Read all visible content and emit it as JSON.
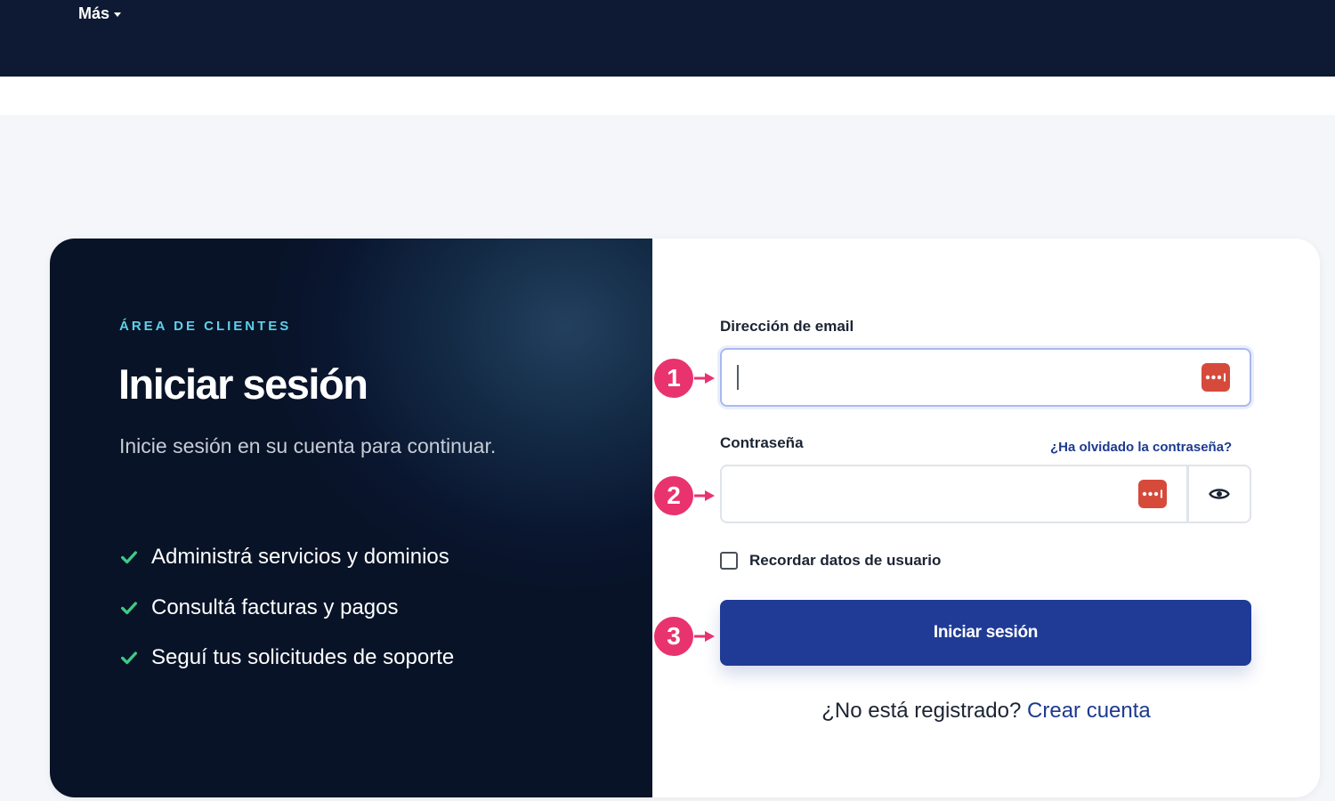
{
  "nav": {
    "more_label": "Más"
  },
  "hero": {
    "eyebrow": "ÁREA DE CLIENTES",
    "title": "Iniciar sesión",
    "subtitle": "Inicie sesión en su cuenta para continuar.",
    "features": [
      "Administrá servicios y dominios",
      "Consultá facturas y pagos",
      "Seguí tus solicitudes de soporte"
    ]
  },
  "form": {
    "email_label": "Dirección de email",
    "email_value": "",
    "password_label": "Contraseña",
    "password_value": "",
    "forgot_label": "¿Ha olvidado la contraseña?",
    "remember_label": "Recordar datos de usuario",
    "remember_checked": false,
    "submit_label": "Iniciar sesión",
    "register_prompt": "¿No está registrado?",
    "register_link": "Crear cuenta"
  },
  "annotations": [
    "1",
    "2",
    "3"
  ],
  "icons": {
    "nav_more": "chevron-down-icon",
    "feature": "check-icon",
    "password_manager": "password-manager-icon",
    "show_password": "eye-icon"
  },
  "colors": {
    "nav_bg": "#0e1a33",
    "panel_dark": "#0a1630",
    "accent_cyan": "#5fd0ea",
    "check_green": "#3ecb87",
    "primary": "#1f3b96",
    "link": "#1d3a8f",
    "annotation": "#e8336f",
    "password_manager": "#d64a3c"
  }
}
